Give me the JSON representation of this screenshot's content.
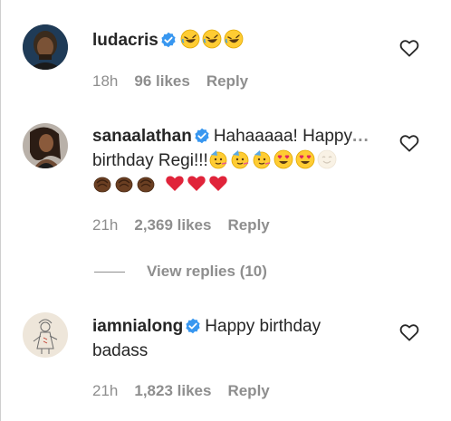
{
  "comments": [
    {
      "username": "ludacris",
      "verified": true,
      "text": "",
      "emoji_line": [
        "rofl-emoji",
        "rofl-emoji",
        "rofl-emoji"
      ],
      "time": "18h",
      "likes": "96 likes",
      "reply": "Reply",
      "heart_icon": "heart-outline-icon"
    },
    {
      "username": "sanaalathan",
      "verified": true,
      "text_line1": "Hahaaaaa! Happy",
      "more": "...",
      "text_line2": "birthday Regi!!!",
      "emoji_line2": [
        "party-face-emoji",
        "party-face-emoji",
        "party-face-emoji",
        "heart-eyes-emoji",
        "heart-eyes-emoji",
        "smiling-face-emoji"
      ],
      "emoji_line3": [
        "clapping-hands-emoji",
        "clapping-hands-emoji",
        "clapping-hands-emoji",
        "red-heart-emoji",
        "red-heart-emoji",
        "red-heart-emoji"
      ],
      "time": "21h",
      "likes": "2,369 likes",
      "reply": "Reply",
      "heart_icon": "heart-outline-icon"
    },
    {
      "username": "iamnialong",
      "verified": true,
      "text_line1": "Happy birthday",
      "text_line2": "badass",
      "time": "21h",
      "likes": "1,823 likes",
      "reply": "Reply",
      "heart_icon": "heart-outline-icon"
    }
  ],
  "view_replies": "View replies (10)",
  "colors": {
    "text": "#262626",
    "muted": "#8e8e8e",
    "verified_blue": "#3897f0"
  }
}
